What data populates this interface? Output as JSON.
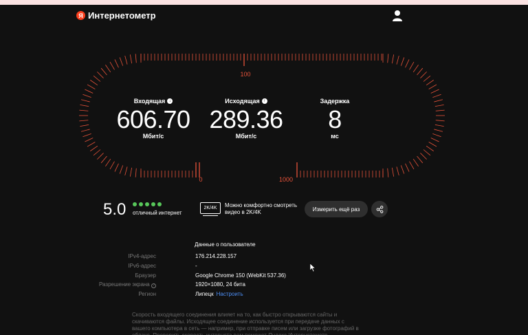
{
  "app": {
    "logo_letter": "Я",
    "title": "Интернетометр"
  },
  "dial": {
    "tick_top_label": "100",
    "tick_left_label": "0",
    "tick_right_label": "1000",
    "accent_color": "#e8533a"
  },
  "metrics": {
    "download": {
      "label": "Входящая",
      "value": "606.70",
      "unit": "Мбит/с",
      "icon": "download-arrow-icon"
    },
    "upload": {
      "label": "Исходящая",
      "value": "289.36",
      "unit": "Мбит/с",
      "icon": "upload-arrow-icon"
    },
    "latency": {
      "label": "Задержка",
      "value": "8",
      "unit": "мс"
    }
  },
  "rating": {
    "score": "5.0",
    "dots_filled": 5,
    "text": "отличный интернет"
  },
  "video": {
    "badge": "2K/4K",
    "text": "Можно комфортно смотреть видео в 2K/4K"
  },
  "actions": {
    "retest_label": "Измерить ещё раз",
    "share_icon": "share-icon"
  },
  "user_data": {
    "title": "Данные о пользователе",
    "rows": [
      {
        "key": "IPv4-адрес",
        "value": "176.214.228.157"
      },
      {
        "key": "IPv6-адрес",
        "value": "-"
      },
      {
        "key": "Браузер",
        "value": "Google Chrome 150 (WebKit 537.36)"
      },
      {
        "key": "Разрешение экрана",
        "value": "1920×1080, 24 бита"
      },
      {
        "key": "Регион",
        "value": "Липецк",
        "link": "Настроить"
      }
    ]
  },
  "description": "Скорость входящего соединения влияет на то, как быстро открываются сайты и скачиваются файлы. Исходящее соединение используется при передаче данных с вашего компьютера в сеть — например, при отправке писем или загрузке фотографий в облако. Проверить скорость интернета вам поможет Яндекс Интернетометр."
}
